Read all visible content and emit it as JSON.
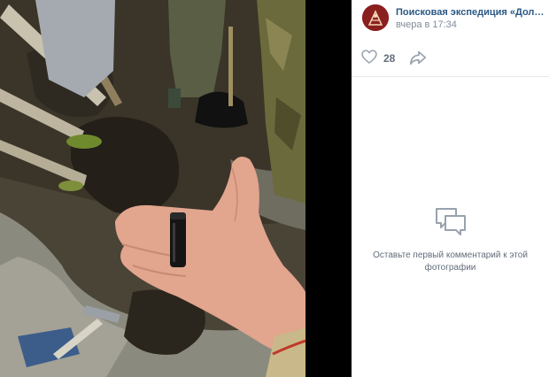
{
  "post": {
    "author": "Поисковая экспедиция «Долина»",
    "author_display": "Поисковая экспедиция «Долина» ...",
    "date": "вчера в 17:34"
  },
  "actions": {
    "likes": "28",
    "like_icon": "heart-icon",
    "share_icon": "share-icon"
  },
  "comments": {
    "empty_icon": "comment-bubble-icon",
    "empty_text": "Оставьте первый комментарий к этой фотографии"
  },
  "colors": {
    "link": "#2a5885",
    "muted": "#818c99",
    "icon": "#99a2ad",
    "panel_bg": "#ffffff",
    "viewer_bg": "#000000"
  }
}
